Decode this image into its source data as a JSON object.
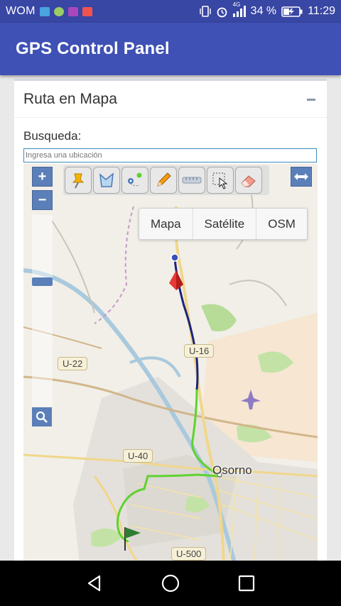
{
  "status_bar": {
    "carrier": "WOM",
    "network": "4G",
    "battery": "34 %",
    "time": "11:29"
  },
  "app_bar": {
    "title": "GPS Control Panel"
  },
  "panel": {
    "title": "Ruta en Mapa",
    "search_label": "Busqueda:",
    "search_placeholder": "Ingresa una ubicación"
  },
  "map": {
    "zoom_in": "+",
    "zoom_out": "−",
    "base_layers": [
      "Mapa",
      "Satélite",
      "OSM"
    ],
    "roads": [
      "U-16",
      "U-22",
      "U-40",
      "U-500"
    ],
    "city": "Osorno",
    "draw_tools": [
      "marker-tool",
      "polygon-tool",
      "route-tool",
      "pencil-tool",
      "measure-tool",
      "select-tool",
      "eraser-tool"
    ]
  },
  "colors": {
    "status_bar": "#3846a4",
    "app_bar": "#3f51b5",
    "route_blue": "#1a237e",
    "route_green": "#5fd22e",
    "map_button": "#5b7fb8"
  }
}
